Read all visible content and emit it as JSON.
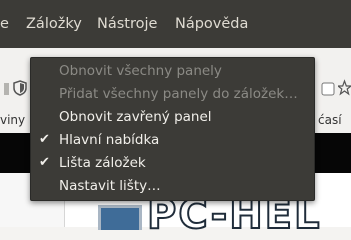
{
  "menubar": {
    "items": [
      {
        "label": "e"
      },
      {
        "label": "Záložky"
      },
      {
        "label": "Nástroje"
      },
      {
        "label": "Nápověda"
      }
    ]
  },
  "toolbar": {
    "left_text": "viny",
    "right_text": "ćasí"
  },
  "context_menu": {
    "items": [
      {
        "label": "Obnovit všechny panely",
        "enabled": false,
        "checked": false
      },
      {
        "label": "Přidat všechny panely do záložek…",
        "enabled": false,
        "checked": false
      },
      {
        "label": "Obnovit zavřený panel",
        "enabled": true,
        "checked": false
      },
      {
        "label": "Hlavní nabídka",
        "enabled": true,
        "checked": true
      },
      {
        "label": "Lišta záložek",
        "enabled": true,
        "checked": true
      },
      {
        "label": "Nastavit lišty…",
        "enabled": true,
        "checked": false
      }
    ]
  },
  "page": {
    "logo_text": "PC-HEL"
  },
  "colors": {
    "menubar_bg": "#3c3b37",
    "menu_bg": "#3c3b37",
    "menu_text": "#f1efea",
    "menu_disabled_text": "#8b8a85"
  }
}
